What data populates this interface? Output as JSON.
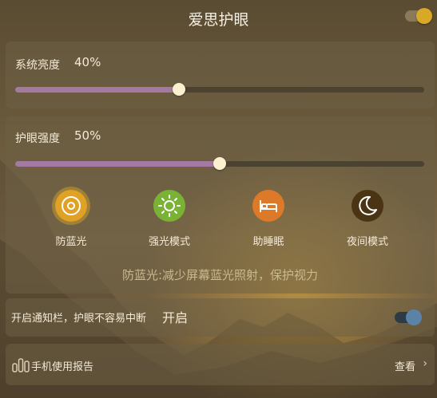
{
  "header": {
    "title": "爱思护眼",
    "master_toggle": "on"
  },
  "brightness": {
    "label": "系统亮度",
    "value_text": "40%",
    "level": 0.4
  },
  "eye_protection": {
    "label": "护眼强度",
    "value_text": "50%",
    "level": 0.5
  },
  "modes": [
    {
      "label": "防蓝光",
      "icon": "blue-light-icon",
      "color": "#e0a226",
      "active": true
    },
    {
      "label": "强光模式",
      "icon": "sun-icon",
      "color": "#79b234",
      "active": false
    },
    {
      "label": "助睡眠",
      "icon": "bed-icon",
      "color": "#dc7a2a",
      "active": false
    },
    {
      "label": "夜间模式",
      "icon": "moon-icon",
      "color": "#4a3414",
      "active": false
    }
  ],
  "description": "防蓝光:减少屏幕蓝光照射，保护视力",
  "notification": {
    "text": "开启通知栏，护眼不容易中断",
    "state": "开启",
    "toggle": "on"
  },
  "report": {
    "label": "手机使用报告",
    "link": "查看"
  }
}
